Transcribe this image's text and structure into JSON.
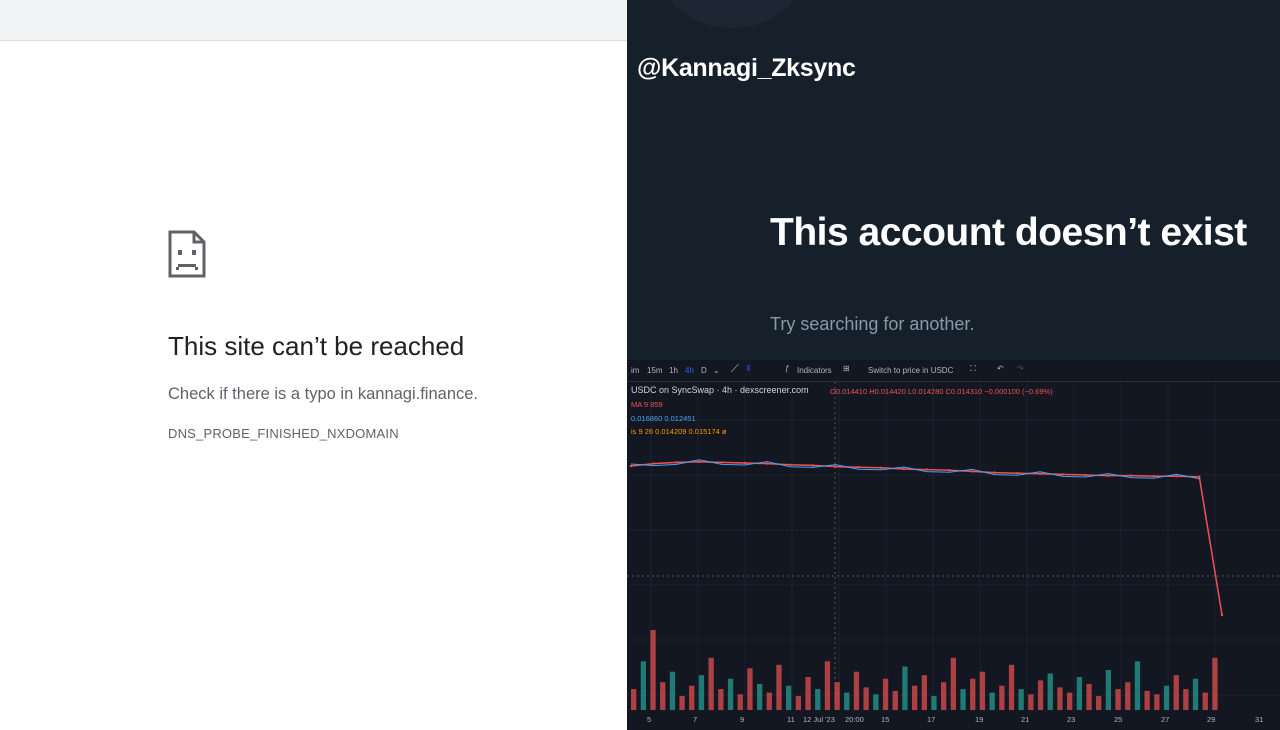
{
  "browser_error": {
    "title": "This site can’t be reached",
    "detail": "Check if there is a typo in kannagi.finance.",
    "code": "DNS_PROBE_FINISHED_NXDOMAIN"
  },
  "twitter": {
    "handle": "@Kannagi_Zksync",
    "headline": "This account doesn’t exist",
    "subtext": "Try searching for another."
  },
  "chart_toolbar": {
    "intervals": [
      "im",
      "15m",
      "1h",
      "4h",
      "D"
    ],
    "active_interval": "4h",
    "indicators_label": "Indicators",
    "switch_label": "Switch to price in USDC"
  },
  "chart_legend": {
    "symbol": "USDC on SyncSwap · 4h · dexscreener.com",
    "ohlc": "O0.014410 H0.014420 L0.014280 C0.014310 −0.000100 (−0.69%)",
    "ma_line": "MA 9   859",
    "line3": "0.016860  0.012451",
    "line4": "is 9 26   0.014209  0.015174  ø"
  },
  "chart_data": {
    "type": "line",
    "title": "USDC on SyncSwap · 4h · dexscreener.com",
    "x_tick_labels": [
      "5",
      "7",
      "9",
      "11",
      "12 Jul '23",
      "20:00",
      "15",
      "17",
      "19",
      "21",
      "23",
      "25",
      "27",
      "29",
      "31"
    ],
    "series": [
      {
        "values": [
          0.01448,
          0.01452,
          0.01454,
          0.01455,
          0.01454,
          0.01453,
          0.01452,
          0.0145,
          0.01449,
          0.01447,
          0.01446,
          0.01445,
          0.01443,
          0.01442,
          0.01441,
          0.01439,
          0.01437,
          0.01436,
          0.01435,
          0.01434,
          0.01433,
          0.01432,
          0.01432,
          0.01431,
          0.01431,
          0.0143,
          0.012
        ]
      }
    ],
    "volume": [
      12,
      28,
      46,
      16,
      22,
      8,
      14,
      20,
      30,
      12,
      18,
      9,
      24,
      15,
      10,
      26,
      14,
      8,
      19,
      12,
      28,
      16,
      10,
      22,
      13,
      9,
      18,
      11,
      25,
      14,
      20,
      8,
      16,
      30,
      12,
      18,
      22,
      10,
      14,
      26,
      12,
      9,
      17,
      21,
      13,
      10,
      19,
      15,
      8,
      23,
      12,
      16,
      28,
      11,
      9,
      14,
      20,
      12,
      18,
      10,
      30
    ],
    "grid": true
  }
}
